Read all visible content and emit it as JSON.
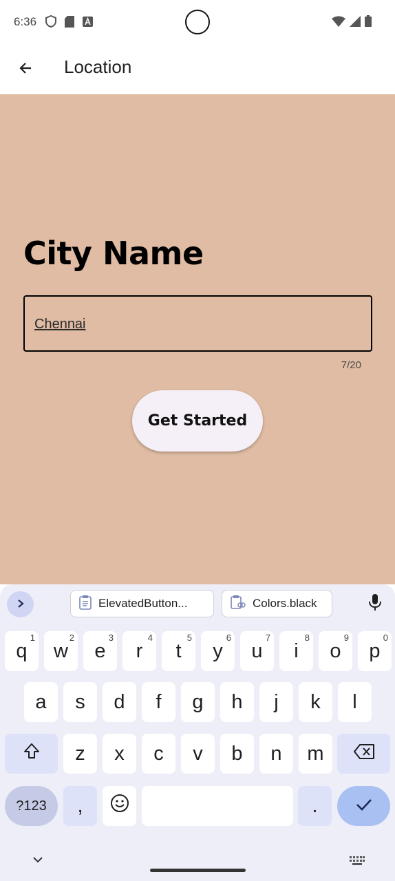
{
  "status_bar": {
    "time": "6:36",
    "left_icons": [
      "shield-icon",
      "sd-card-icon",
      "font-icon"
    ],
    "right_icons": [
      "wifi-icon",
      "signal-icon",
      "battery-icon"
    ]
  },
  "app_bar": {
    "title": "Location",
    "back_icon": "arrow-back-icon"
  },
  "main": {
    "background": "#dfbca3",
    "heading": "City Name",
    "field": {
      "value": "Chennai",
      "counter": "7/20"
    },
    "button_label": "Get Started"
  },
  "keyboard": {
    "suggestions": [
      "ElevatedButton...",
      "Colors.black"
    ],
    "row1": [
      {
        "k": "q",
        "h": "1"
      },
      {
        "k": "w",
        "h": "2"
      },
      {
        "k": "e",
        "h": "3"
      },
      {
        "k": "r",
        "h": "4"
      },
      {
        "k": "t",
        "h": "5"
      },
      {
        "k": "y",
        "h": "6"
      },
      {
        "k": "u",
        "h": "7"
      },
      {
        "k": "i",
        "h": "8"
      },
      {
        "k": "o",
        "h": "9"
      },
      {
        "k": "p",
        "h": "0"
      }
    ],
    "row2": [
      "a",
      "s",
      "d",
      "f",
      "g",
      "h",
      "j",
      "k",
      "l"
    ],
    "row3": [
      "z",
      "x",
      "c",
      "v",
      "b",
      "n",
      "m"
    ],
    "symbols_label": "?123",
    "comma": ",",
    "period": ".",
    "accent": "#a9c0f2"
  }
}
